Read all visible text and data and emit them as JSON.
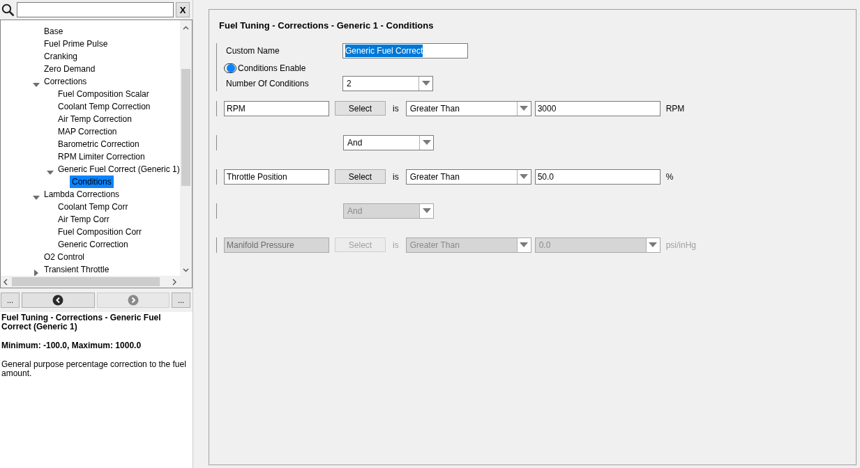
{
  "search": {
    "clear_label": "X"
  },
  "tree": [
    {
      "label": "Base",
      "selected": false
    },
    {
      "label": "Fuel Prime Pulse",
      "selected": false
    },
    {
      "label": "Cranking",
      "selected": false
    },
    {
      "label": "Zero Demand",
      "selected": false
    },
    {
      "label": "Corrections",
      "selected": false,
      "expanded": true,
      "children": [
        {
          "label": "Fuel Composition Scalar",
          "selected": false
        },
        {
          "label": "Coolant Temp Correction",
          "selected": false
        },
        {
          "label": "Air Temp Correction",
          "selected": false
        },
        {
          "label": "MAP Correction",
          "selected": false
        },
        {
          "label": "Barometric Correction",
          "selected": false
        },
        {
          "label": "RPM Limiter Correction",
          "selected": false
        },
        {
          "label": "Generic Fuel Correct (Generic 1)",
          "selected": false,
          "expanded": true,
          "children": [
            {
              "label": "Conditions",
              "selected": true
            }
          ]
        }
      ]
    },
    {
      "label": "Lambda Corrections",
      "selected": false,
      "expanded": true,
      "children": [
        {
          "label": "Coolant Temp Corr",
          "selected": false
        },
        {
          "label": "Air Temp Corr",
          "selected": false
        },
        {
          "label": "Fuel Composition Corr",
          "selected": false
        },
        {
          "label": "Generic Correction",
          "selected": false
        }
      ]
    },
    {
      "label": "O2 Control",
      "selected": false
    },
    {
      "label": "Transient Throttle",
      "selected": false,
      "expanded": false
    }
  ],
  "nav_buttons": [
    {
      "kind": "more",
      "label": "..."
    },
    {
      "kind": "back",
      "disabled": false
    },
    {
      "kind": "forward",
      "disabled": true
    },
    {
      "kind": "more",
      "label": "..."
    }
  ],
  "description": {
    "title": "Fuel Tuning - Corrections - Generic Fuel Correct (Generic 1)",
    "range": "Minimum: -100.0, Maximum: 1000.0",
    "text": "General purpose percentage correction to the fuel amount."
  },
  "panel": {
    "title": "Fuel Tuning - Corrections - Generic 1 - Conditions",
    "custom_name": {
      "label": "Custom Name",
      "value": "Generic Fuel Correct"
    },
    "conditions_enable": {
      "label": "Conditions Enable",
      "on": true
    },
    "number_of_conditions": {
      "label": "Number Of Conditions",
      "value": "2"
    },
    "rows": [
      {
        "kind": "condition",
        "channel": "RPM",
        "button": "Select",
        "is": "is",
        "comparison": "Greater Than",
        "value": {
          "kind": "text",
          "text": "3000"
        },
        "unit": "RPM",
        "disabled": false
      },
      {
        "kind": "operator",
        "value": "And",
        "disabled": false
      },
      {
        "kind": "condition",
        "channel": "Throttle Position",
        "button": "Select",
        "is": "is",
        "comparison": "Greater Than",
        "value": {
          "kind": "text",
          "text": "50.0"
        },
        "unit": "%",
        "disabled": false
      },
      {
        "kind": "operator",
        "value": "And",
        "disabled": true
      },
      {
        "kind": "condition",
        "channel": "Manifold Pressure",
        "button": "Select",
        "is": "is",
        "comparison": "Greater Than",
        "value": {
          "kind": "dropdown",
          "text": "0.0"
        },
        "unit": "psi/inHg",
        "disabled": true
      }
    ]
  }
}
